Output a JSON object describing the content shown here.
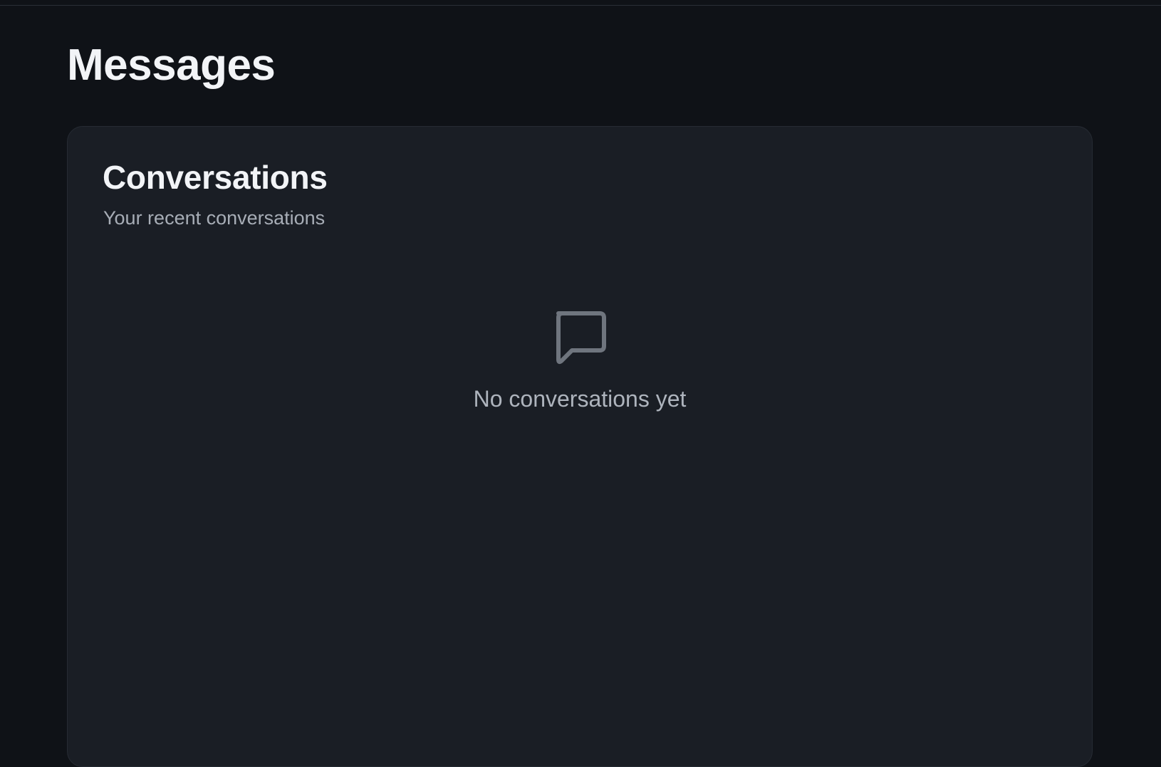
{
  "page": {
    "title": "Messages"
  },
  "conversations_card": {
    "title": "Conversations",
    "subtitle": "Your recent conversations",
    "empty_state": {
      "icon": "message-square-icon",
      "text": "No conversations yet"
    }
  },
  "colors": {
    "background": "#0f1217",
    "card": "#1a1e25",
    "title_text": "#f2f4f7",
    "muted_text": "#a7adb6",
    "icon": "#6f757e"
  }
}
